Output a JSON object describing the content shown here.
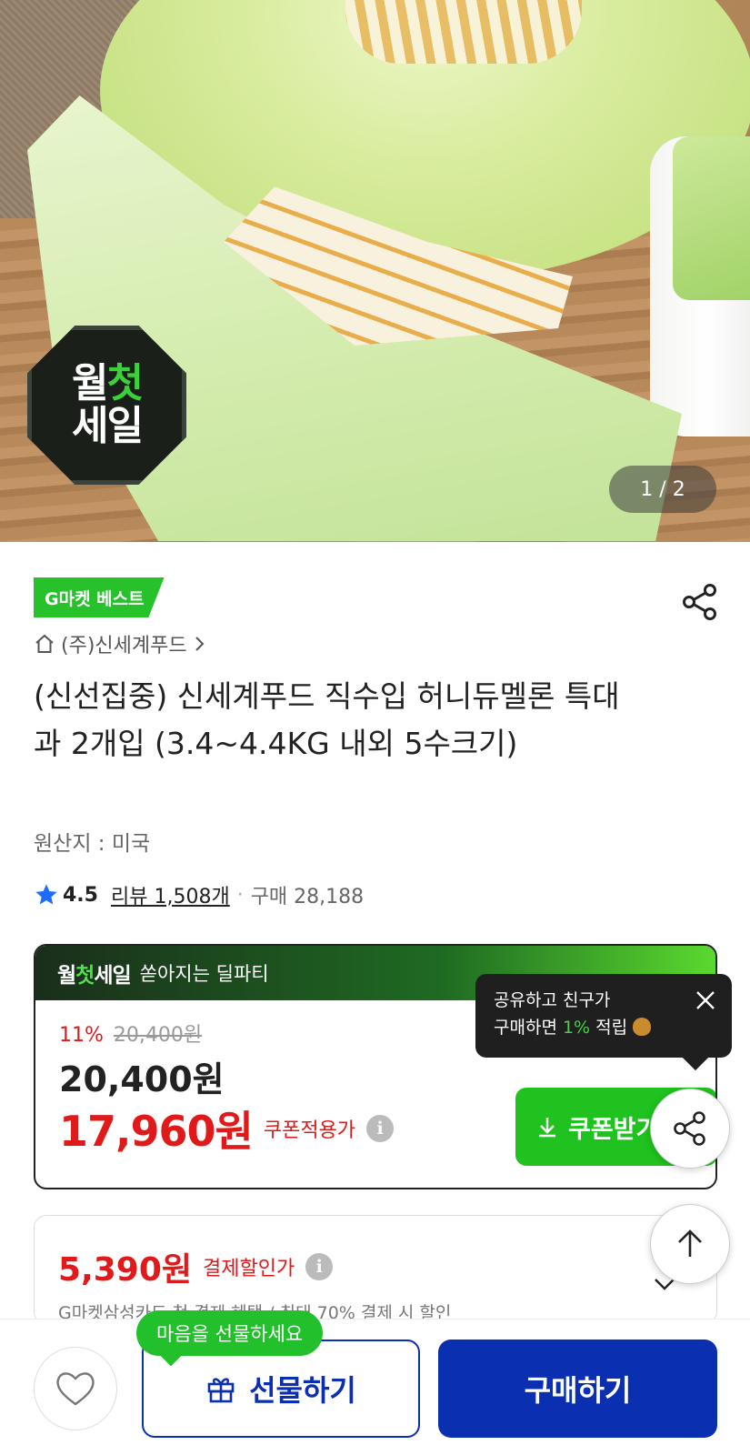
{
  "hero": {
    "badge_line1_white": "월",
    "badge_line1_green": "첫",
    "badge_line2": "세일",
    "page_indicator": "1 / 2"
  },
  "product": {
    "best_badge": "G마켓 베스트",
    "seller": "(주)신세계푸드",
    "title": "(신선집중) 신세계푸드 직수입 허니듀멜론 특대과 2개입 (3.4~4.4KG 내외 5수크기)",
    "origin": "원산지 : 미국",
    "rating": "4.5",
    "review_label": "리뷰 1,508개",
    "purchase_label": "구매 28,188"
  },
  "price_box": {
    "brand_white1": "월",
    "brand_green": "첫",
    "brand_white2": "세일",
    "header_sub": "쏟아지는 딜파티",
    "discount_pct": "11%",
    "original_price": "20,400원",
    "price": "20,400원",
    "coupon_price": "17,960원",
    "coupon_label": "쿠폰적용가",
    "coupon_button": "쿠폰받기"
  },
  "tooltip": {
    "line1": "공유하고 친구가",
    "line2_pre": "구매하면 ",
    "line2_hl": "1%",
    "line2_post": " 적립"
  },
  "pay_box": {
    "price": "5,390원",
    "label": "결제할인가",
    "desc": "G마켓삼성카드 첫 결제 혜택 / 최대 70% 결제 시 할인"
  },
  "bottom": {
    "gift_bubble": "마음을 선물하세요",
    "gift_button": "선물하기",
    "buy_button": "구매하기"
  },
  "colors": {
    "accent_green": "#26c12b",
    "price_red": "#e01a1a",
    "primary_blue": "#0a2fb0"
  }
}
